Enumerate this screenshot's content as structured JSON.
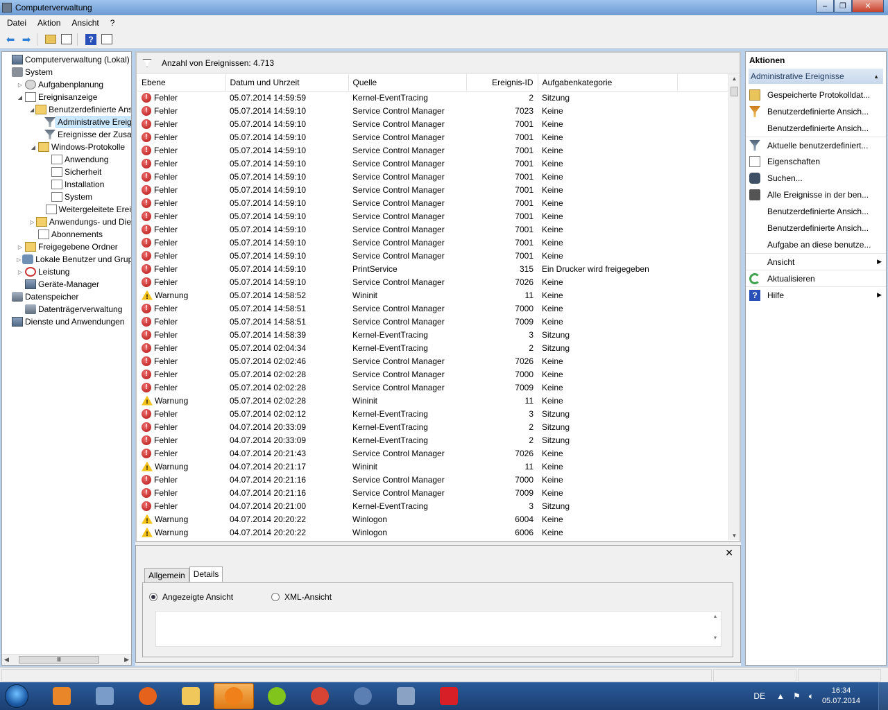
{
  "window": {
    "title": "Computerverwaltung",
    "controls": {
      "minimize": "–",
      "maximize": "❐",
      "close": "✕"
    }
  },
  "menu": [
    "Datei",
    "Aktion",
    "Ansicht",
    "?"
  ],
  "tree": [
    {
      "label": "Computerverwaltung (Lokal)",
      "indent": 0,
      "icon": "computer-icon",
      "exp": ""
    },
    {
      "label": "System",
      "indent": 0,
      "icon": "tools-icon",
      "exp": ""
    },
    {
      "label": "Aufgabenplanung",
      "indent": 1,
      "icon": "clock-icon",
      "exp": "▷"
    },
    {
      "label": "Ereignisanzeige",
      "indent": 1,
      "icon": "event-viewer-icon",
      "exp": "◢"
    },
    {
      "label": "Benutzerdefinierte Ans",
      "indent": 2,
      "icon": "folder-icon",
      "exp": "◢"
    },
    {
      "label": "Administrative Ereig",
      "indent": 3,
      "icon": "filter-icon",
      "exp": "",
      "selected": true
    },
    {
      "label": "Ereignisse der Zusa",
      "indent": 3,
      "icon": "filter-icon",
      "exp": ""
    },
    {
      "label": "Windows-Protokolle",
      "indent": 2,
      "icon": "folder-icon",
      "exp": "◢"
    },
    {
      "label": "Anwendung",
      "indent": 3,
      "icon": "log-icon",
      "exp": ""
    },
    {
      "label": "Sicherheit",
      "indent": 3,
      "icon": "log-icon",
      "exp": ""
    },
    {
      "label": "Installation",
      "indent": 3,
      "icon": "log-icon",
      "exp": ""
    },
    {
      "label": "System",
      "indent": 3,
      "icon": "log-icon",
      "exp": ""
    },
    {
      "label": "Weitergeleitete Erei",
      "indent": 3,
      "icon": "log-icon",
      "exp": ""
    },
    {
      "label": "Anwendungs- und Die",
      "indent": 2,
      "icon": "folder-icon",
      "exp": "▷"
    },
    {
      "label": "Abonnements",
      "indent": 2,
      "icon": "log-icon",
      "exp": ""
    },
    {
      "label": "Freigegebene Ordner",
      "indent": 1,
      "icon": "shared-folder-icon",
      "exp": "▷"
    },
    {
      "label": "Lokale Benutzer und Grupp",
      "indent": 1,
      "icon": "users-icon",
      "exp": "▷"
    },
    {
      "label": "Leistung",
      "indent": 1,
      "icon": "performance-icon",
      "exp": "▷"
    },
    {
      "label": "Geräte-Manager",
      "indent": 1,
      "icon": "device-manager-icon",
      "exp": ""
    },
    {
      "label": "Datenspeicher",
      "indent": 0,
      "icon": "storage-icon",
      "exp": ""
    },
    {
      "label": "Datenträgerverwaltung",
      "indent": 1,
      "icon": "disk-icon",
      "exp": ""
    },
    {
      "label": "Dienste und Anwendungen",
      "indent": 0,
      "icon": "services-icon",
      "exp": ""
    }
  ],
  "tree_scroll_thumb": "lll",
  "events": {
    "count_label": "Anzahl von Ereignissen: 4.713",
    "columns": [
      "Ebene",
      "Datum und Uhrzeit",
      "Quelle",
      "Ereignis-ID",
      "Aufgabenkategorie"
    ],
    "rows": [
      [
        "Fehler",
        "05.07.2014 14:59:59",
        "Kernel-EventTracing",
        "2",
        "Sitzung"
      ],
      [
        "Fehler",
        "05.07.2014 14:59:10",
        "Service Control Manager",
        "7023",
        "Keine"
      ],
      [
        "Fehler",
        "05.07.2014 14:59:10",
        "Service Control Manager",
        "7001",
        "Keine"
      ],
      [
        "Fehler",
        "05.07.2014 14:59:10",
        "Service Control Manager",
        "7001",
        "Keine"
      ],
      [
        "Fehler",
        "05.07.2014 14:59:10",
        "Service Control Manager",
        "7001",
        "Keine"
      ],
      [
        "Fehler",
        "05.07.2014 14:59:10",
        "Service Control Manager",
        "7001",
        "Keine"
      ],
      [
        "Fehler",
        "05.07.2014 14:59:10",
        "Service Control Manager",
        "7001",
        "Keine"
      ],
      [
        "Fehler",
        "05.07.2014 14:59:10",
        "Service Control Manager",
        "7001",
        "Keine"
      ],
      [
        "Fehler",
        "05.07.2014 14:59:10",
        "Service Control Manager",
        "7001",
        "Keine"
      ],
      [
        "Fehler",
        "05.07.2014 14:59:10",
        "Service Control Manager",
        "7001",
        "Keine"
      ],
      [
        "Fehler",
        "05.07.2014 14:59:10",
        "Service Control Manager",
        "7001",
        "Keine"
      ],
      [
        "Fehler",
        "05.07.2014 14:59:10",
        "Service Control Manager",
        "7001",
        "Keine"
      ],
      [
        "Fehler",
        "05.07.2014 14:59:10",
        "Service Control Manager",
        "7001",
        "Keine"
      ],
      [
        "Fehler",
        "05.07.2014 14:59:10",
        "PrintService",
        "315",
        "Ein Drucker wird freigegeben"
      ],
      [
        "Fehler",
        "05.07.2014 14:59:10",
        "Service Control Manager",
        "7026",
        "Keine"
      ],
      [
        "Warnung",
        "05.07.2014 14:58:52",
        "Wininit",
        "11",
        "Keine"
      ],
      [
        "Fehler",
        "05.07.2014 14:58:51",
        "Service Control Manager",
        "7000",
        "Keine"
      ],
      [
        "Fehler",
        "05.07.2014 14:58:51",
        "Service Control Manager",
        "7009",
        "Keine"
      ],
      [
        "Fehler",
        "05.07.2014 14:58:39",
        "Kernel-EventTracing",
        "3",
        "Sitzung"
      ],
      [
        "Fehler",
        "05.07.2014 02:04:34",
        "Kernel-EventTracing",
        "2",
        "Sitzung"
      ],
      [
        "Fehler",
        "05.07.2014 02:02:46",
        "Service Control Manager",
        "7026",
        "Keine"
      ],
      [
        "Fehler",
        "05.07.2014 02:02:28",
        "Service Control Manager",
        "7000",
        "Keine"
      ],
      [
        "Fehler",
        "05.07.2014 02:02:28",
        "Service Control Manager",
        "7009",
        "Keine"
      ],
      [
        "Warnung",
        "05.07.2014 02:02:28",
        "Wininit",
        "11",
        "Keine"
      ],
      [
        "Fehler",
        "05.07.2014 02:02:12",
        "Kernel-EventTracing",
        "3",
        "Sitzung"
      ],
      [
        "Fehler",
        "04.07.2014 20:33:09",
        "Kernel-EventTracing",
        "2",
        "Sitzung"
      ],
      [
        "Fehler",
        "04.07.2014 20:33:09",
        "Kernel-EventTracing",
        "2",
        "Sitzung"
      ],
      [
        "Fehler",
        "04.07.2014 20:21:43",
        "Service Control Manager",
        "7026",
        "Keine"
      ],
      [
        "Warnung",
        "04.07.2014 20:21:17",
        "Wininit",
        "11",
        "Keine"
      ],
      [
        "Fehler",
        "04.07.2014 20:21:16",
        "Service Control Manager",
        "7000",
        "Keine"
      ],
      [
        "Fehler",
        "04.07.2014 20:21:16",
        "Service Control Manager",
        "7009",
        "Keine"
      ],
      [
        "Fehler",
        "04.07.2014 20:21:00",
        "Kernel-EventTracing",
        "3",
        "Sitzung"
      ],
      [
        "Warnung",
        "04.07.2014 20:20:22",
        "Winlogon",
        "6004",
        "Keine"
      ],
      [
        "Warnung",
        "04.07.2014 20:20:22",
        "Winlogon",
        "6006",
        "Keine"
      ]
    ]
  },
  "detail": {
    "close": "✕",
    "tabs": [
      "Allgemein",
      "Details"
    ],
    "radio_friendly": "Angezeigte Ansicht",
    "radio_xml": "XML-Ansicht"
  },
  "actions": {
    "title": "Aktionen",
    "section": "Administrative Ereignisse",
    "items": [
      {
        "label": "Gespeicherte Protokolldat...",
        "icon": "open-log-icon",
        "cls": "open",
        "arrow": ""
      },
      {
        "label": "Benutzerdefinierte Ansich...",
        "icon": "create-view-icon",
        "cls": "filter",
        "arrow": ""
      },
      {
        "label": "Benutzerdefinierte Ansich...",
        "icon": "import-view-icon",
        "cls": "blank",
        "arrow": ""
      },
      {
        "label": "Aktuelle benutzerdefiniert...",
        "icon": "filter-icon",
        "cls": "filter2",
        "arrow": "",
        "sep": true
      },
      {
        "label": "Eigenschaften",
        "icon": "properties-icon",
        "cls": "props",
        "arrow": ""
      },
      {
        "label": "Suchen...",
        "icon": "find-icon",
        "cls": "find",
        "arrow": ""
      },
      {
        "label": "Alle Ereignisse in der ben...",
        "icon": "save-icon",
        "cls": "save",
        "arrow": ""
      },
      {
        "label": "Benutzerdefinierte Ansich...",
        "icon": "export-view-icon",
        "cls": "blank",
        "arrow": ""
      },
      {
        "label": "Benutzerdefinierte Ansich...",
        "icon": "copy-view-icon",
        "cls": "blank",
        "arrow": ""
      },
      {
        "label": "Aufgabe an diese benutze...",
        "icon": "attach-task-icon",
        "cls": "blank",
        "arrow": ""
      },
      {
        "label": "Ansicht",
        "icon": "view-icon",
        "cls": "blank",
        "arrow": "▶",
        "sep": true
      },
      {
        "label": "Aktualisieren",
        "icon": "refresh-icon",
        "cls": "refresh",
        "arrow": "",
        "sep": true
      },
      {
        "label": "Hilfe",
        "icon": "help-icon",
        "cls": "help",
        "arrow": "▶",
        "sep": true
      }
    ]
  },
  "taskbar": {
    "apps": [
      {
        "name": "media-player-icon",
        "color": "#e9862a",
        "active": false
      },
      {
        "name": "connect-icon",
        "color": "#7a9cc9",
        "active": false
      },
      {
        "name": "firefox-icon",
        "color": "#e5621c",
        "active": false
      },
      {
        "name": "explorer-icon",
        "color": "#f0c75a",
        "active": false
      },
      {
        "name": "origin-icon",
        "color": "#f08019",
        "active": true
      },
      {
        "name": "spotify-icon",
        "color": "#80c41c",
        "active": false
      },
      {
        "name": "chrome-icon",
        "color": "#d84434",
        "active": false
      },
      {
        "name": "teamspeak-icon",
        "color": "#5b7fb3",
        "active": false
      },
      {
        "name": "computer-management-icon",
        "color": "#8aa3c4",
        "active": false
      },
      {
        "name": "tv14-icon",
        "color": "#d61f26",
        "active": false
      }
    ],
    "lang": "DE",
    "time": "16:34",
    "date": "05.07.2014"
  },
  "colors": {
    "error": "#c41a1a",
    "warning": "#f3c21b",
    "selection": "#cce8ff",
    "taskbar": "#1f4a82"
  }
}
